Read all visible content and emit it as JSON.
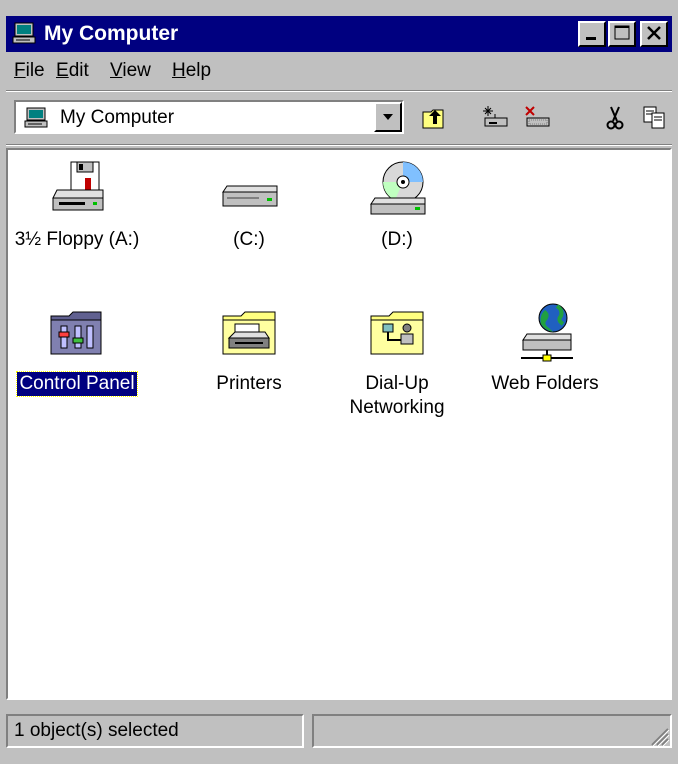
{
  "window": {
    "title": "My Computer",
    "controls": [
      "minimize",
      "maximize",
      "close"
    ]
  },
  "menu": [
    {
      "label": "File",
      "key": "F",
      "rest": "ile"
    },
    {
      "label": "Edit",
      "key": "E",
      "rest": "dit"
    },
    {
      "label": "View",
      "key": "V",
      "rest": "iew"
    },
    {
      "label": "Help",
      "key": "H",
      "rest": "elp"
    }
  ],
  "address": {
    "value": "My Computer"
  },
  "toolbar": {
    "buttons": [
      "up-folder",
      "map-drive",
      "disconnect-drive",
      "cut",
      "copy"
    ]
  },
  "items": [
    {
      "label": "3½ Floppy (A:)",
      "icon": "floppy-drive-icon"
    },
    {
      "label": "(C:)",
      "icon": "hard-drive-icon"
    },
    {
      "label": "(D:)",
      "icon": "cd-drive-icon"
    },
    {
      "label": "Control Panel",
      "icon": "control-panel-icon",
      "selected": true
    },
    {
      "label": "Printers",
      "icon": "printers-folder-icon"
    },
    {
      "label": "Dial-Up Networking",
      "icon": "dialup-folder-icon"
    },
    {
      "label": "Web Folders",
      "icon": "web-folders-icon"
    }
  ],
  "status": {
    "text": "1 object(s) selected"
  },
  "colors": {
    "titlebar": "#000080",
    "face": "#c0c0c0",
    "selection": "#000080"
  }
}
